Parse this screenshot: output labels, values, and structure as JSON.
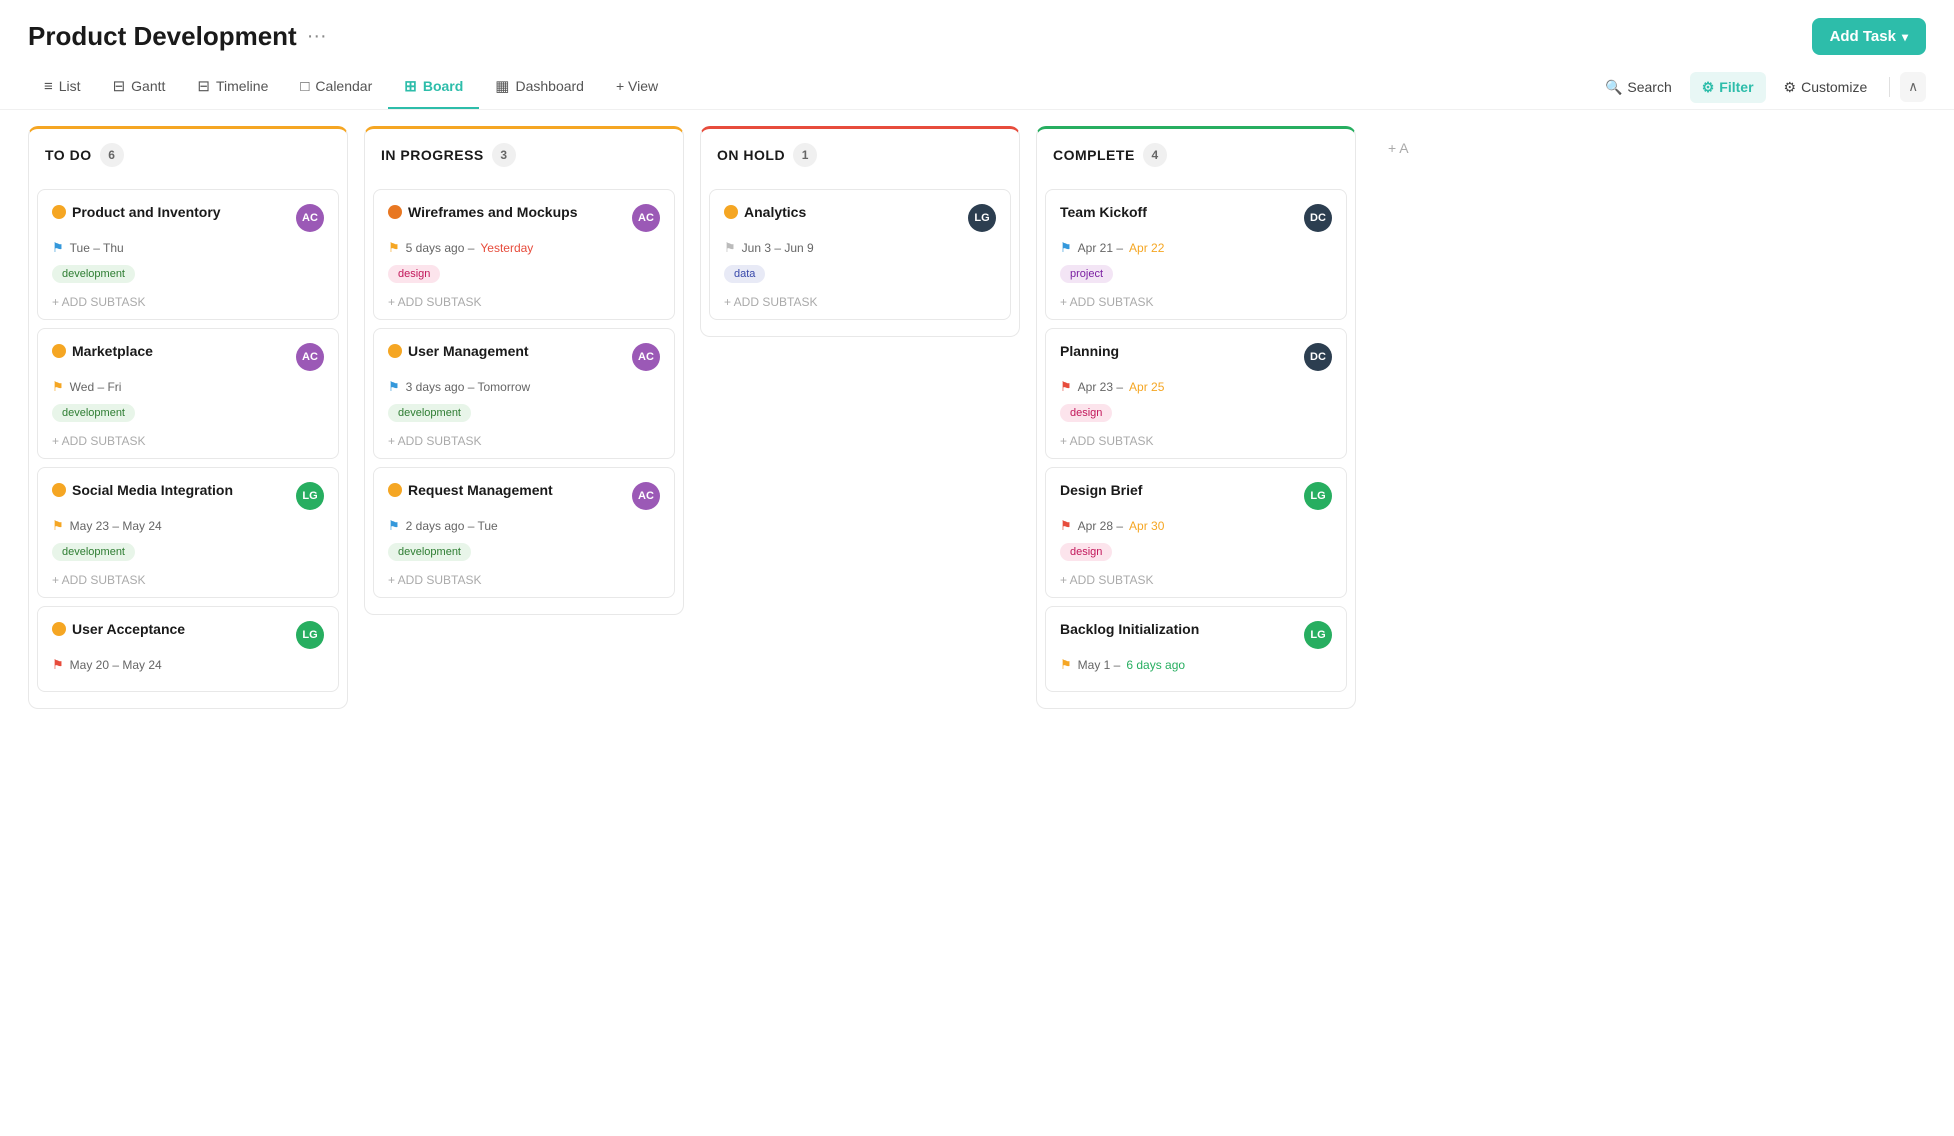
{
  "page": {
    "title": "Product Development",
    "more_label": "···"
  },
  "header": {
    "add_task_label": "Add Task",
    "chevron": "▾"
  },
  "nav": {
    "tabs": [
      {
        "id": "list",
        "label": "List",
        "icon": "≡",
        "active": false
      },
      {
        "id": "gantt",
        "label": "Gantt",
        "icon": "📊",
        "active": false
      },
      {
        "id": "timeline",
        "label": "Timeline",
        "icon": "📅",
        "active": false
      },
      {
        "id": "calendar",
        "label": "Calendar",
        "icon": "🗓",
        "active": false
      },
      {
        "id": "board",
        "label": "Board",
        "icon": "⊞",
        "active": true
      },
      {
        "id": "dashboard",
        "label": "Dashboard",
        "icon": "▦",
        "active": false
      },
      {
        "id": "view",
        "label": "+ View",
        "icon": "",
        "active": false
      }
    ],
    "search_label": "Search",
    "filter_label": "Filter",
    "customize_label": "Customize",
    "collapse_icon": "∧"
  },
  "columns": [
    {
      "id": "todo",
      "title": "TO DO",
      "count": "6",
      "color_class": "todo",
      "cards": [
        {
          "id": "card-1",
          "title": "Product and Inventory",
          "status": "yellow",
          "avatar_initials": "AC",
          "avatar_color": "avatar-purple",
          "flag_color": "flag-blue",
          "date_text": "Tue – Thu",
          "date_highlight": "",
          "tag": "development",
          "tag_class": "tag-development",
          "add_subtask": "+ ADD SUBTASK"
        },
        {
          "id": "card-2",
          "title": "Marketplace",
          "status": "yellow",
          "avatar_initials": "AC",
          "avatar_color": "avatar-purple",
          "flag_color": "flag-yellow",
          "date_text": "Wed – Fri",
          "date_highlight": "",
          "tag": "development",
          "tag_class": "tag-development",
          "add_subtask": "+ ADD SUBTASK"
        },
        {
          "id": "card-3",
          "title": "Social Media Integration",
          "status": "yellow",
          "avatar_initials": "LG",
          "avatar_color": "avatar-green",
          "flag_color": "flag-yellow",
          "date_text": "May 23 – May 24",
          "date_highlight": "",
          "tag": "development",
          "tag_class": "tag-development",
          "add_subtask": "+ ADD SUBTASK"
        },
        {
          "id": "card-4",
          "title": "User Acceptance",
          "status": "yellow",
          "avatar_initials": "LG",
          "avatar_color": "avatar-green",
          "flag_color": "flag-red",
          "date_text": "May 20 – May 24",
          "date_highlight": "",
          "tag": "",
          "tag_class": "",
          "add_subtask": ""
        }
      ]
    },
    {
      "id": "inprogress",
      "title": "IN PROGRESS",
      "count": "3",
      "color_class": "inprogress",
      "cards": [
        {
          "id": "card-5",
          "title": "Wireframes and Mockups",
          "status": "orange",
          "avatar_initials": "AC",
          "avatar_color": "avatar-purple",
          "flag_color": "flag-yellow",
          "date_text": "5 days ago – Yesterday",
          "date_highlight": "overdue",
          "tag": "design",
          "tag_class": "tag-design",
          "add_subtask": "+ ADD SUBTASK"
        },
        {
          "id": "card-6",
          "title": "User Management",
          "status": "yellow",
          "avatar_initials": "AC",
          "avatar_color": "avatar-purple",
          "flag_color": "flag-blue",
          "date_text": "3 days ago – Tomorrow",
          "date_highlight": "",
          "tag": "development",
          "tag_class": "tag-development",
          "add_subtask": "+ ADD SUBTASK"
        },
        {
          "id": "card-7",
          "title": "Request Management",
          "status": "yellow",
          "avatar_initials": "AC",
          "avatar_color": "avatar-purple",
          "flag_color": "flag-blue",
          "date_text": "2 days ago – Tue",
          "date_highlight": "",
          "tag": "development",
          "tag_class": "tag-development",
          "add_subtask": "+ ADD SUBTASK"
        }
      ]
    },
    {
      "id": "onhold",
      "title": "ON HOLD",
      "count": "1",
      "color_class": "onhold",
      "cards": [
        {
          "id": "card-8",
          "title": "Analytics",
          "status": "yellow",
          "avatar_initials": "LG",
          "avatar_color": "avatar-dark",
          "flag_color": "flag-gray",
          "date_text": "Jun 3 – Jun 9",
          "date_highlight": "",
          "tag": "data",
          "tag_class": "tag-data",
          "add_subtask": "+ ADD SUBTASK"
        }
      ]
    },
    {
      "id": "complete",
      "title": "COMPLETE",
      "count": "4",
      "color_class": "complete",
      "cards": [
        {
          "id": "card-9",
          "title": "Team Kickoff",
          "status": "none",
          "avatar_initials": "DC",
          "avatar_color": "avatar-dark",
          "flag_color": "flag-blue",
          "date_text": "Apr 21 – Apr 22",
          "date_highlight": "warning",
          "tag": "project",
          "tag_class": "tag-project",
          "add_subtask": "+ ADD SUBTASK"
        },
        {
          "id": "card-10",
          "title": "Planning",
          "status": "none",
          "avatar_initials": "DC",
          "avatar_color": "avatar-dark",
          "flag_color": "flag-red",
          "date_text": "Apr 23 – Apr 25",
          "date_highlight": "warning",
          "tag": "design",
          "tag_class": "tag-design",
          "add_subtask": "+ ADD SUBTASK"
        },
        {
          "id": "card-11",
          "title": "Design Brief",
          "status": "none",
          "avatar_initials": "LG",
          "avatar_color": "avatar-green",
          "flag_color": "flag-red",
          "date_text": "Apr 28 – Apr 30",
          "date_highlight": "warning",
          "tag": "design",
          "tag_class": "tag-design",
          "add_subtask": "+ ADD SUBTASK"
        },
        {
          "id": "card-12",
          "title": "Backlog Initialization",
          "status": "none",
          "avatar_initials": "LG",
          "avatar_color": "avatar-green",
          "flag_color": "flag-yellow",
          "date_text": "May 1 – 6 days ago",
          "date_highlight": "green",
          "tag": "",
          "tag_class": "",
          "add_subtask": ""
        }
      ]
    }
  ],
  "add_column_label": "+ A"
}
